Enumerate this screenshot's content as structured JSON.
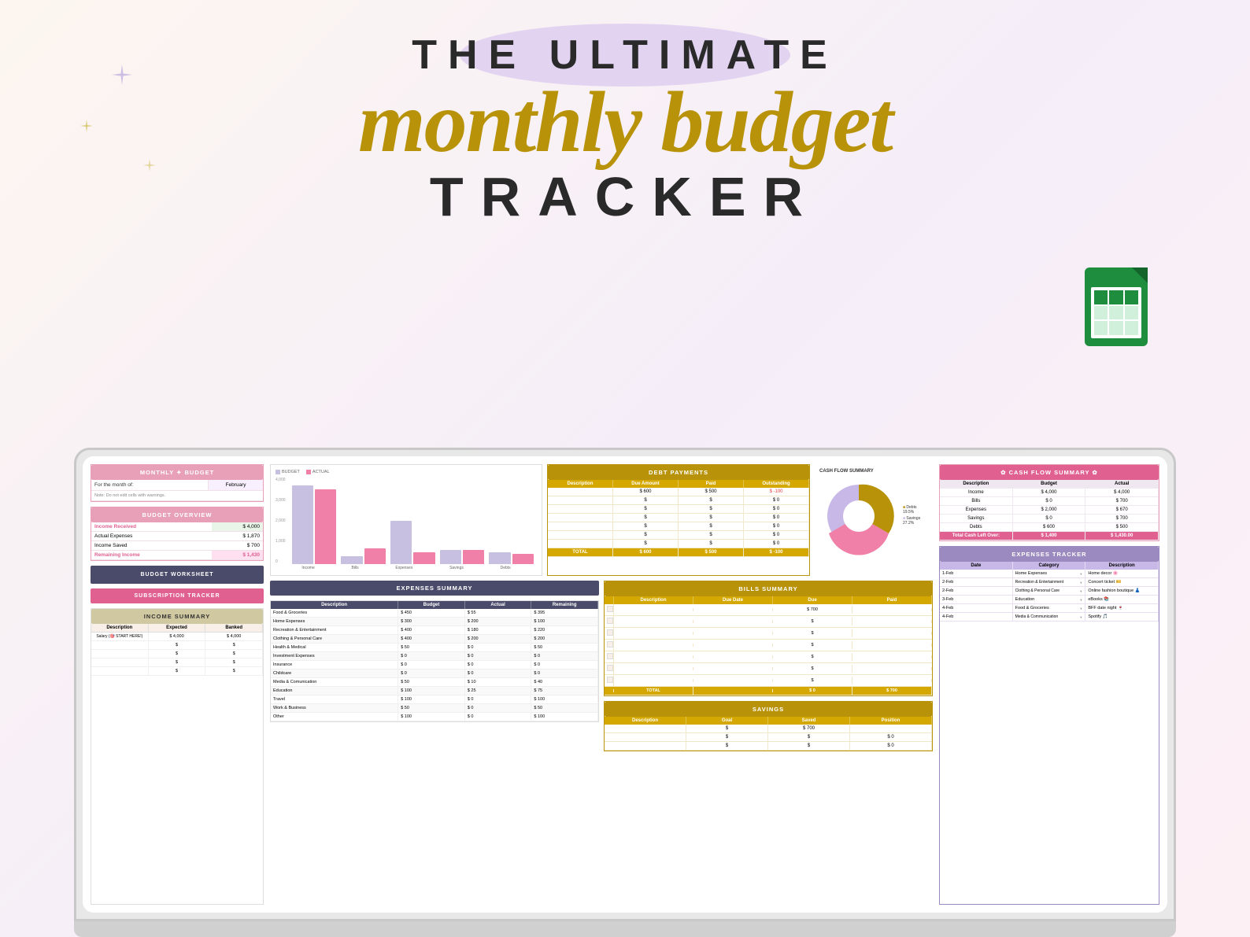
{
  "title": "The Ultimate Monthly Budget Tracker",
  "heading": {
    "the_ultimate": "THE ULTIMATE",
    "monthly_budget": "monthly budget",
    "tracker": "TRACKER"
  },
  "monthly_budget_section": {
    "header": "MONTHLY ✦ BUDGET",
    "month_label": "For the month of:",
    "month_value": "February",
    "note": "Note: Do not edit cells with warnings."
  },
  "budget_overview": {
    "header": "BUDGET OVERVIEW",
    "rows": [
      {
        "label": "Income Received",
        "value": "$ 4,000",
        "style": "pink"
      },
      {
        "label": "Actual Expenses",
        "value": "$ 1,870"
      },
      {
        "label": "Income Saved",
        "value": "$ 700"
      },
      {
        "label": "Remaining Income",
        "value": "$ 1,430",
        "style": "pink"
      }
    ]
  },
  "chart": {
    "legend": [
      "BUDGET",
      "ACTUAL"
    ],
    "y_labels": [
      "4,000",
      "3,000",
      "2,000",
      "1,000",
      "0"
    ],
    "x_labels": [
      "Income",
      "Bills",
      "Expenses",
      "Savings",
      "Debts"
    ],
    "bars": [
      {
        "budget": 100,
        "actual": 95
      },
      {
        "budget": 10,
        "actual": 20
      },
      {
        "budget": 55,
        "actual": 15
      },
      {
        "budget": 18,
        "actual": 18
      },
      {
        "budget": 15,
        "actual": 13
      }
    ]
  },
  "debt_payments": {
    "header": "DEBT PAYMENTS",
    "columns": [
      "Description",
      "Due Amount",
      "Paid",
      "Outstanding"
    ],
    "rows": [
      {
        "desc": "",
        "due": "$ 600",
        "paid": "$ 500",
        "outstanding": "$ -100"
      },
      {
        "desc": "",
        "due": "$",
        "paid": "$",
        "outstanding": "$ 0"
      },
      {
        "desc": "",
        "due": "$",
        "paid": "$",
        "outstanding": "$ 0"
      },
      {
        "desc": "",
        "due": "$",
        "paid": "$",
        "outstanding": "$ 0"
      },
      {
        "desc": "",
        "due": "$",
        "paid": "$",
        "outstanding": "$ 0"
      },
      {
        "desc": "",
        "due": "$",
        "paid": "$",
        "outstanding": "$ 0"
      },
      {
        "desc": "",
        "due": "$",
        "paid": "$",
        "outstanding": "$ 0"
      }
    ],
    "total_row": {
      "desc": "TOTAL",
      "due": "$ 600",
      "paid": "$ 500",
      "outstanding": "$ -100"
    }
  },
  "cash_flow_summary_top": {
    "title": "CASH FLOW SUMMARY",
    "labels": [
      {
        "name": "Debts",
        "pct": "19.5%"
      },
      {
        "name": "Savings",
        "pct": "27.2%"
      }
    ],
    "pie_segments": [
      {
        "color": "#b8930a",
        "pct": 25
      },
      {
        "color": "#f080a8",
        "pct": 35
      },
      {
        "color": "#c8b8e8",
        "pct": 40
      }
    ]
  },
  "budget_worksheet": {
    "label": "BUDGET WORKSHEET"
  },
  "subscription_tracker": {
    "label": "SUBSCRIPTION TRACKER"
  },
  "income_summary": {
    "header": "INCOME SUMMARY",
    "columns": [
      "Description",
      "Expected",
      "Banked"
    ],
    "rows": [
      {
        "desc": "Salary (🎯 START HERE!)",
        "expected": "$ 4,000",
        "banked": "$ 4,000"
      },
      {
        "desc": "",
        "expected": "$",
        "banked": "$"
      },
      {
        "desc": "",
        "expected": "$",
        "banked": "$"
      },
      {
        "desc": "",
        "expected": "$",
        "banked": "$"
      },
      {
        "desc": "",
        "expected": "$",
        "banked": "$"
      },
      {
        "desc": "",
        "expected": "$",
        "banked": "$"
      }
    ]
  },
  "expenses_summary": {
    "header": "EXPENSES SUMMARY",
    "columns": [
      "Description",
      "Budget",
      "Actual",
      "Remaining"
    ],
    "rows": [
      {
        "desc": "Food & Groceries",
        "budget": "$ 450",
        "actual": "$ 55",
        "remaining": "$ 395"
      },
      {
        "desc": "Home Expenses",
        "budget": "$ 300",
        "actual": "$ 200",
        "remaining": "$ 100"
      },
      {
        "desc": "Recreation & Entertainment",
        "budget": "$ 400",
        "actual": "$ 180",
        "remaining": "$ 220"
      },
      {
        "desc": "Clothing & Personal Care",
        "budget": "$ 400",
        "actual": "$ 200",
        "remaining": "$ 200"
      },
      {
        "desc": "Health & Medical",
        "budget": "$ 50",
        "actual": "$ 0",
        "remaining": "$ 50"
      },
      {
        "desc": "Investment Expenses",
        "budget": "$ 0",
        "actual": "$ 0",
        "remaining": "$ 0"
      },
      {
        "desc": "Insurance",
        "budget": "$ 0",
        "actual": "$ 0",
        "remaining": "$ 0"
      },
      {
        "desc": "Childcare",
        "budget": "$ 0",
        "actual": "$ 0",
        "remaining": "$ 0"
      },
      {
        "desc": "Media & Comunication",
        "budget": "$ 50",
        "actual": "$ 10",
        "remaining": "$ 40"
      },
      {
        "desc": "Education",
        "budget": "$ 100",
        "actual": "$ 25",
        "remaining": "$ 75"
      },
      {
        "desc": "Travel",
        "budget": "$ 100",
        "actual": "$ 0",
        "remaining": "$ 100"
      },
      {
        "desc": "Work & Business",
        "budget": "$ 50",
        "actual": "$ 0",
        "remaining": "$ 50"
      },
      {
        "desc": "Other",
        "budget": "$ 100",
        "actual": "$ 0",
        "remaining": "$ 100"
      }
    ]
  },
  "bills_summary": {
    "header": "BILLS SUMMARY",
    "columns": [
      "",
      "Description",
      "Due Date",
      "Due",
      "Paid"
    ],
    "rows": [
      {
        "desc": "",
        "due_date": "",
        "due": "$ 700",
        "paid": ""
      },
      {
        "desc": "",
        "due_date": "",
        "due": "$",
        "paid": ""
      },
      {
        "desc": "",
        "due_date": "",
        "due": "$",
        "paid": ""
      },
      {
        "desc": "",
        "due_date": "",
        "due": "$",
        "paid": ""
      },
      {
        "desc": "",
        "due_date": "",
        "due": "$",
        "paid": ""
      },
      {
        "desc": "",
        "due_date": "",
        "due": "$",
        "paid": ""
      },
      {
        "desc": "",
        "due_date": "",
        "due": "$",
        "paid": ""
      }
    ],
    "total_row": {
      "desc": "TOTAL",
      "due_date": "",
      "due": "$ 0",
      "paid": "$ 700"
    }
  },
  "savings": {
    "header": "SAVINGS",
    "columns": [
      "Description",
      "Goal",
      "Saved",
      "Position"
    ],
    "rows": [
      {
        "desc": "",
        "goal": "$",
        "saved": "$ 700",
        "position": ""
      },
      {
        "desc": "",
        "goal": "$",
        "saved": "$",
        "position": "$ 0"
      },
      {
        "desc": "",
        "goal": "$",
        "saved": "$",
        "position": "$ 0"
      }
    ]
  },
  "cash_flow_summary_right": {
    "header": "✿ CASH FLOW SUMMARY ✿",
    "columns": [
      "Description",
      "Budget",
      "Actual"
    ],
    "rows": [
      {
        "desc": "Income",
        "budget": "$ 4,000",
        "actual": "$ 4,000"
      },
      {
        "desc": "Bills",
        "budget": "$ 0",
        "actual": "$ 700"
      },
      {
        "desc": "Expenses",
        "budget": "$ 2,000",
        "actual": "$ 670"
      },
      {
        "desc": "Savings",
        "budget": "$ 0",
        "actual": "$ 700"
      },
      {
        "desc": "Debts",
        "budget": "$ 600",
        "actual": "$ 500"
      }
    ],
    "total_row": {
      "desc": "Total Cash Left Over:",
      "budget": "$ 1,400",
      "actual": "$ 1,430.00"
    }
  },
  "expenses_tracker": {
    "header": "EXPENSES TRACKER",
    "columns": [
      "Date",
      "Category",
      "Description"
    ],
    "rows": [
      {
        "date": "1-Feb",
        "category": "Home Expenses",
        "desc": "Home decor 🌸"
      },
      {
        "date": "2-Feb",
        "category": "Recreation & Entertainment",
        "desc": "Concert ticket 🎫"
      },
      {
        "date": "2-Feb",
        "category": "Clothing & Personal Care",
        "desc": "Online fashion boutique 👗"
      },
      {
        "date": "3-Feb",
        "category": "Education",
        "desc": "eBooks 📚"
      },
      {
        "date": "4-Feb",
        "category": "Food & Groceries",
        "desc": "BFF date night 🍷"
      },
      {
        "date": "4-Feb",
        "category": "Media & Communication",
        "desc": "Spotify 🎵"
      }
    ]
  }
}
